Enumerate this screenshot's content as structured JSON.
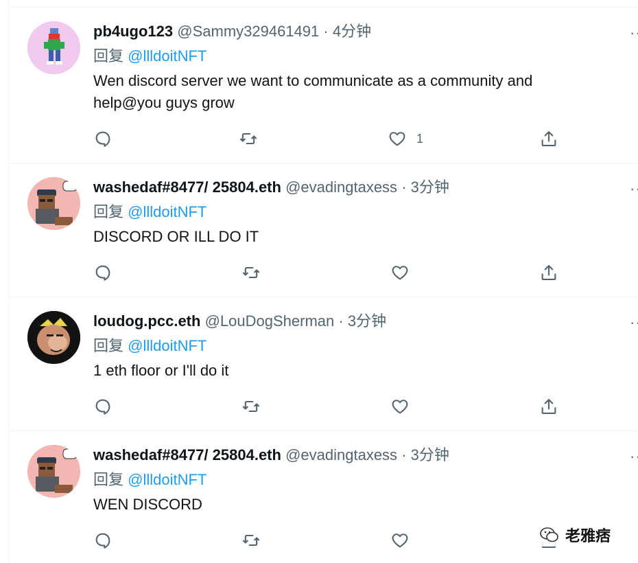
{
  "tweets": [
    {
      "name": "pb4ugo123",
      "handle": "@Sammy329461491",
      "dot": "·",
      "time": "4分钟",
      "reply_prefix": "回复 ",
      "reply_to": "@llldoitNFT",
      "text": "Wen discord server we want to communicate as a community and help@you guys grow",
      "like_count": "1",
      "more": "···"
    },
    {
      "name": "washedaf#8477/ 25804.eth",
      "handle": "@evadingtaxess",
      "dot": "·",
      "time": "3分钟",
      "reply_prefix": "回复 ",
      "reply_to": "@llldoitNFT",
      "text": "DISCORD OR ILL DO IT",
      "like_count": "",
      "more": "···"
    },
    {
      "name": "loudog.pcc.eth",
      "handle": "@LouDogSherman",
      "dot": "·",
      "time": "3分钟",
      "reply_prefix": "回复 ",
      "reply_to": "@llldoitNFT",
      "text": "1 eth floor or I'll do it",
      "like_count": "",
      "more": "···"
    },
    {
      "name": "washedaf#8477/ 25804.eth",
      "handle": "@evadingtaxess",
      "dot": "·",
      "time": "3分钟",
      "reply_prefix": "回复 ",
      "reply_to": "@llldoitNFT",
      "text": "WEN DISCORD",
      "like_count": "",
      "more": "···"
    }
  ],
  "watermark": {
    "text": "老雅痞"
  },
  "icons": {
    "reply": "reply-icon",
    "retweet": "retweet-icon",
    "like": "heart-icon",
    "share": "share-icon"
  },
  "colors": {
    "link": "#1d9bf0",
    "secondary": "#536471",
    "text": "#0f1419"
  }
}
